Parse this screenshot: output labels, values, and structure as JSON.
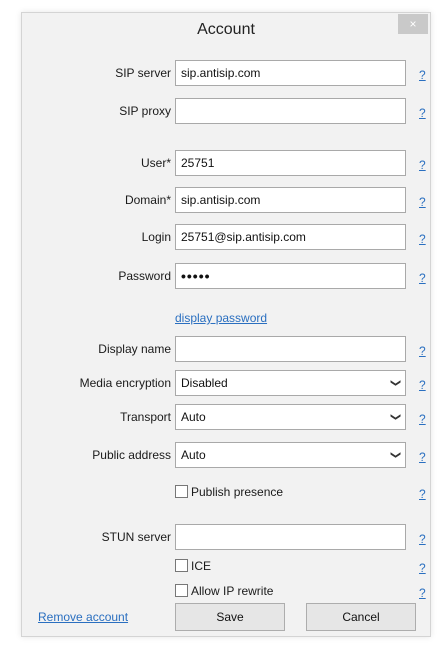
{
  "window": {
    "title": "Account",
    "close_label": "×"
  },
  "help_label": "?",
  "fields": {
    "sip_server": {
      "label": "SIP server",
      "value": "sip.antisip.com"
    },
    "sip_proxy": {
      "label": "SIP proxy",
      "value": ""
    },
    "user": {
      "label": "User*",
      "value": "25751"
    },
    "domain": {
      "label": "Domain*",
      "value": "sip.antisip.com"
    },
    "login": {
      "label": "Login",
      "value": "25751@sip.antisip.com"
    },
    "password": {
      "label": "Password",
      "value": "•••••"
    },
    "display_password_link": "display password",
    "display_name": {
      "label": "Display name",
      "value": ""
    },
    "media_encryption": {
      "label": "Media encryption",
      "value": "Disabled"
    },
    "transport": {
      "label": "Transport",
      "value": "Auto"
    },
    "public_address": {
      "label": "Public address",
      "value": "Auto"
    },
    "publish_presence": {
      "label": "Publish presence",
      "checked": false
    },
    "stun_server": {
      "label": "STUN server",
      "value": ""
    },
    "ice": {
      "label": "ICE",
      "checked": false
    },
    "allow_ip_rewrite": {
      "label": "Allow IP rewrite",
      "checked": false
    }
  },
  "footer": {
    "remove_account": "Remove account",
    "save": "Save",
    "cancel": "Cancel"
  },
  "colors": {
    "link": "#2a6fc0",
    "window_bg": "#f2f2f2"
  },
  "icons": {
    "dropdown": "chevron-down-icon",
    "close": "close-icon"
  }
}
